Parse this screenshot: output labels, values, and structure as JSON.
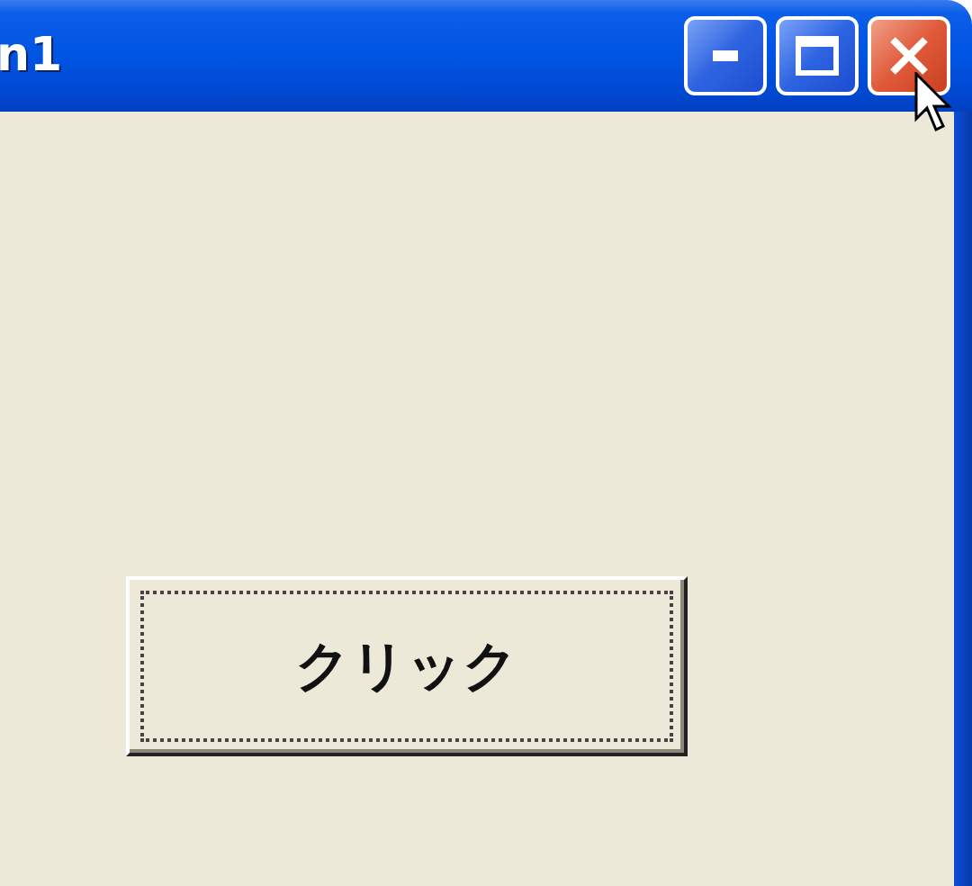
{
  "window": {
    "title": "n1"
  },
  "title_buttons": [
    {
      "kind": "minimize"
    },
    {
      "kind": "maximize"
    },
    {
      "kind": "close"
    }
  ],
  "button": {
    "label": "クリック",
    "focused": true
  }
}
